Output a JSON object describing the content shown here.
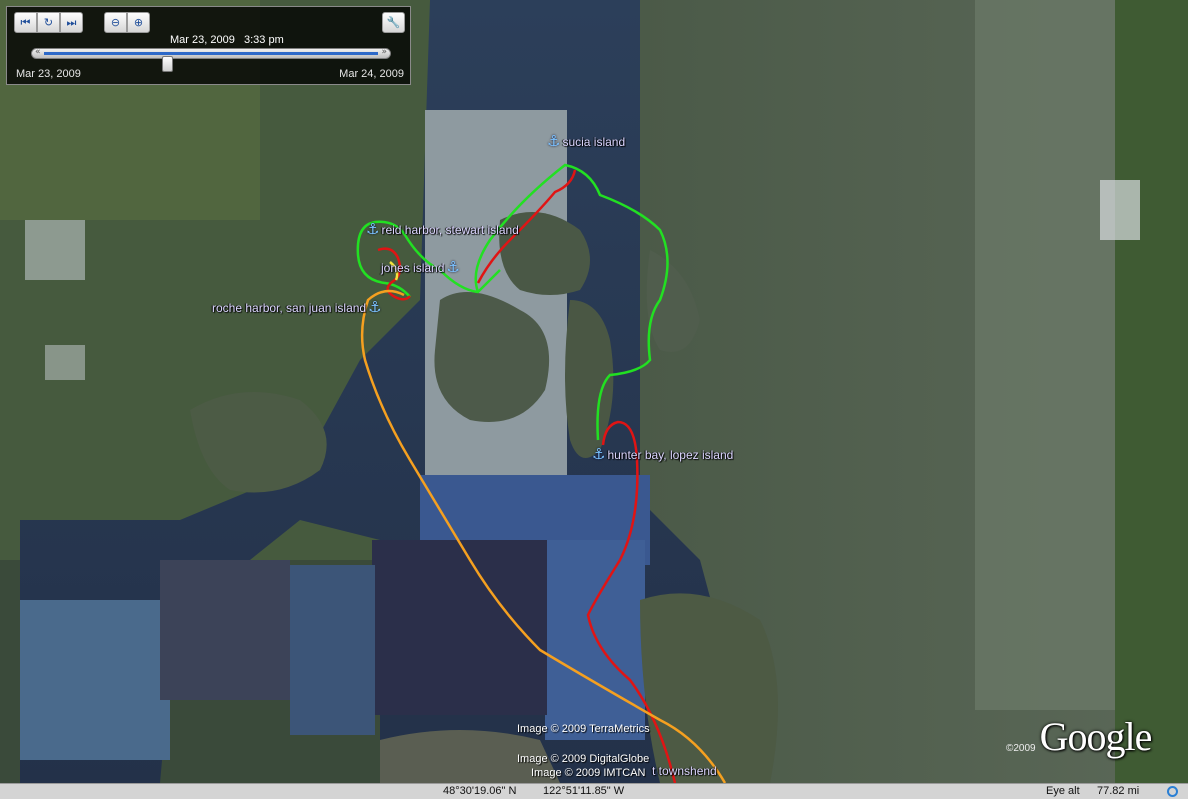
{
  "time_slider": {
    "current_time": "Mar 23, 2009   3:33 pm",
    "start_date": "Mar 23, 2009",
    "end_date": "Mar 24, 2009",
    "position": 0.37,
    "buttons": {
      "prev": "⏮",
      "play": "↻",
      "next": "⏭",
      "zoom_out": "⊖",
      "zoom_in": "⊕",
      "options": "🔧"
    },
    "track_left": "«",
    "track_right": "»"
  },
  "placemarks": [
    {
      "name": "sucia island",
      "icon": "anchor-icon"
    },
    {
      "name": "reid harbor, stewart island",
      "icon": "anchor-icon"
    },
    {
      "name": "jones island",
      "icon": "anchor-icon"
    },
    {
      "name": "roche harbor, san juan island",
      "icon": "anchor-icon"
    },
    {
      "name": "hunter bay, lopez island",
      "icon": "anchor-icon"
    }
  ],
  "partial_label": "t townshend",
  "credits": [
    "Image © 2009 TerraMetrics",
    "Image © 2009 DigitalGlobe",
    "Image © 2009 IMTCAN"
  ],
  "status": {
    "latitude": "48°30'19.06\" N",
    "longitude": "122°51'11.85\" W",
    "eye_alt_label": "Eye alt",
    "eye_alt": "77.82 mi"
  },
  "logo": {
    "year": "©2009",
    "word": "Google"
  },
  "anchor_glyph": "⚓",
  "track_colors": {
    "green": "#22e022",
    "red": "#e01414",
    "orange": "#f5a020",
    "yellow": "#f2e23a"
  }
}
